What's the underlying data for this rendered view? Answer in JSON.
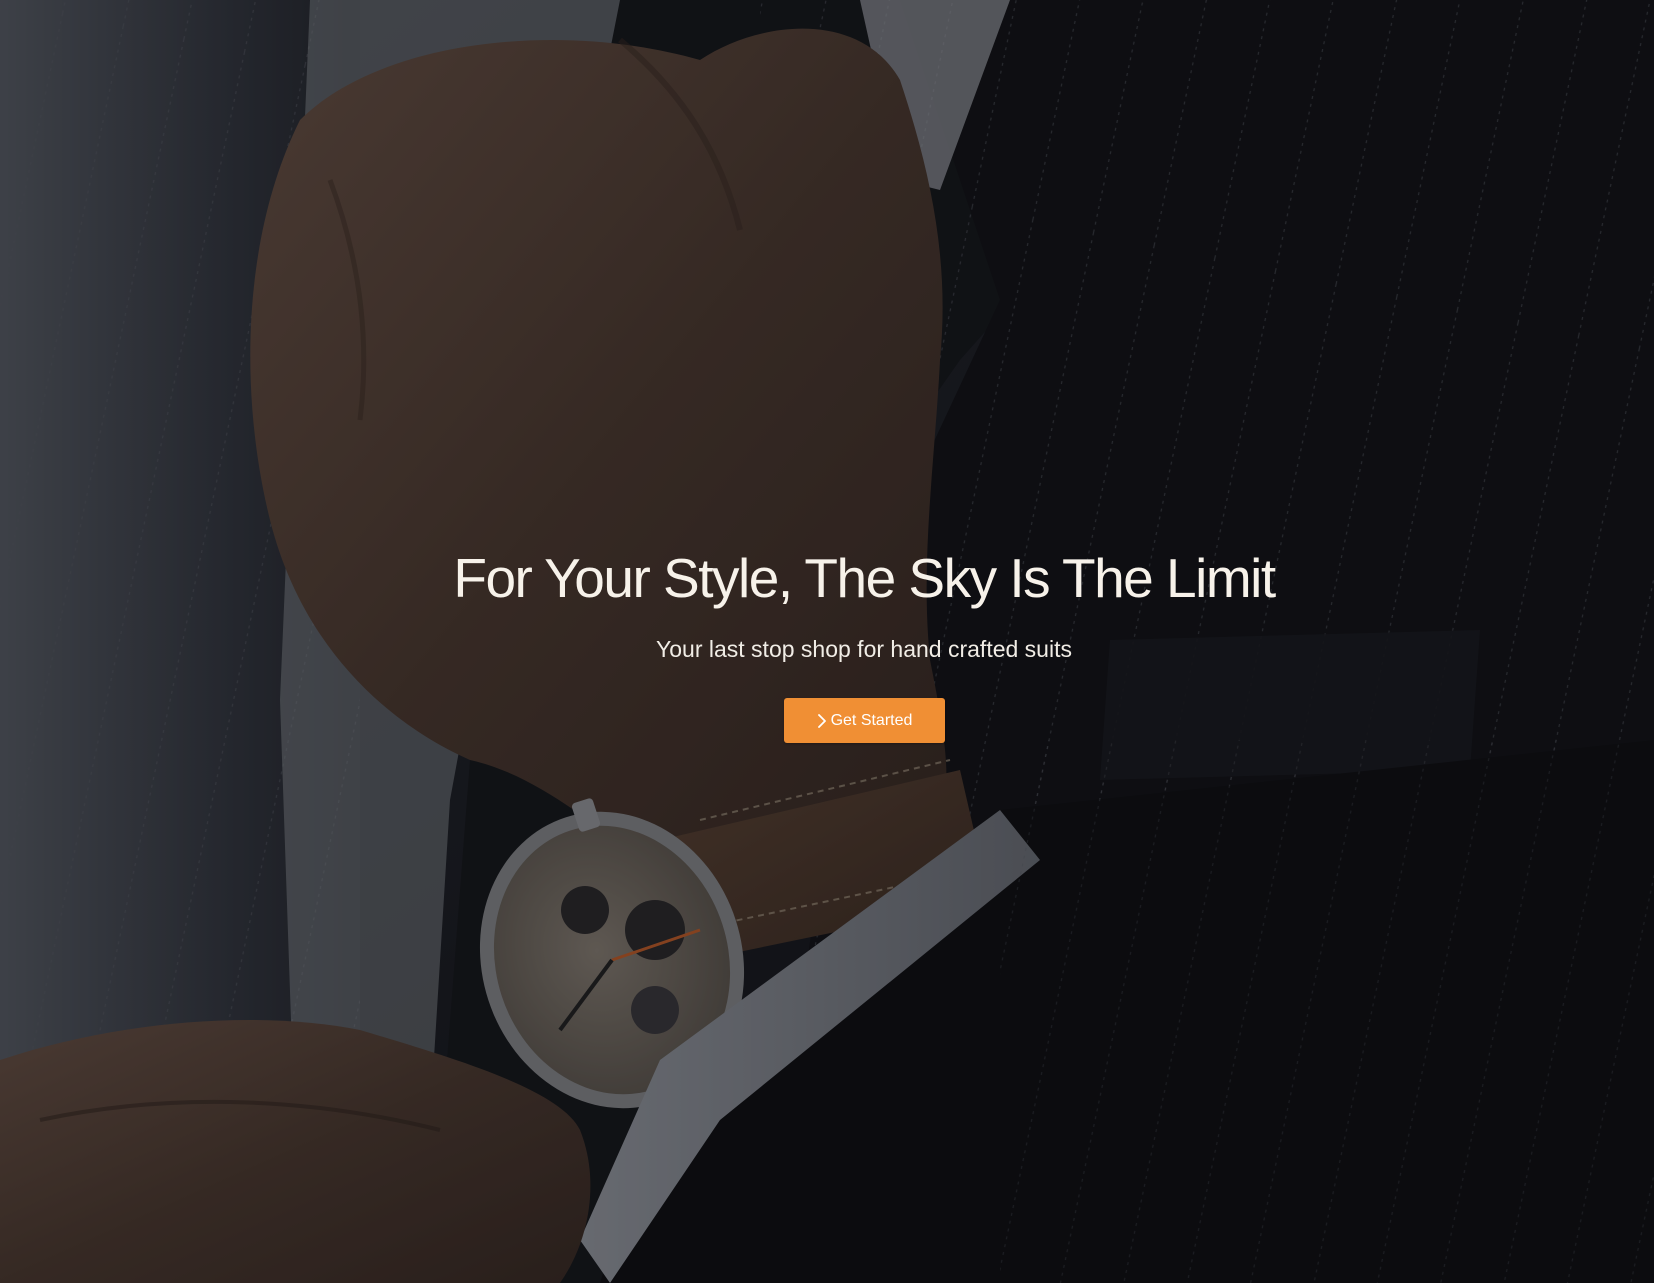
{
  "hero": {
    "title": "For Your Style, The Sky Is The Limit",
    "subtitle": "Your last stop shop for hand crafted suits",
    "cta_label": "Get Started",
    "cta_icon": "chevron-right-icon",
    "background_image": "man-in-pinstripe-suit-with-wristwatch-photo"
  },
  "colors": {
    "accent": "#f08f34",
    "title_text": "#f7f2ea",
    "overlay": "#08090c"
  }
}
